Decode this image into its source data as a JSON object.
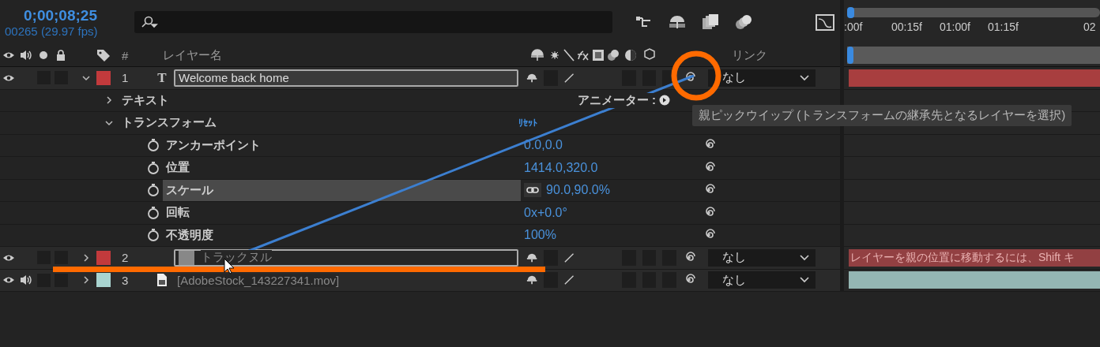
{
  "timecode": "0;00;08;25",
  "frame_info": "00265 (29.97 fps)",
  "ruler": {
    "ticks": [
      ":00f",
      "00:15f",
      "01:00f",
      "01:15f",
      "02"
    ],
    "level": 0
  },
  "headers": {
    "number": "#",
    "layer_name": "レイヤー名",
    "parent": "リンク"
  },
  "layers": [
    {
      "number": "1",
      "type_glyph": "T",
      "kind": "text",
      "name": "Welcome back home",
      "color": "#c23a3c",
      "visible": true,
      "audio": false,
      "expanded": true,
      "highlighted": true,
      "parent": "なし",
      "groups": [
        {
          "label": "テキスト",
          "expanded": false,
          "extra": "アニメーター :"
        },
        {
          "label": "トランスフォーム",
          "expanded": true,
          "extra": "ﾘｾｯﾄ",
          "properties": [
            {
              "name": "アンカーポイント",
              "value": "0.0,0.0",
              "selected": false,
              "linked": false
            },
            {
              "name": "位置",
              "value": "1414.0,320.0",
              "selected": false,
              "linked": false
            },
            {
              "name": "スケール",
              "value": "90.0,90.0%",
              "selected": true,
              "linked": true
            },
            {
              "name": "回転",
              "value": "0x+0.0°",
              "selected": false,
              "linked": false
            },
            {
              "name": "不透明度",
              "value": "100%",
              "selected": false,
              "linked": false
            }
          ]
        }
      ]
    },
    {
      "number": "2",
      "kind": "null",
      "name": "トラックヌル",
      "color": "#c23a3c",
      "visible": true,
      "audio": false,
      "expanded": false,
      "highlighted": true,
      "parent": "なし",
      "bar_text": "レイヤーを親の位置に移動するには、Shift キ"
    },
    {
      "number": "3",
      "kind": "footage",
      "name": "[AdobeStock_143227341.mov]",
      "color": "#a9d4d0",
      "visible": true,
      "audio": true,
      "expanded": false,
      "highlighted": false,
      "parent": "なし"
    }
  ],
  "tooltip": "親ピックウイップ (トランスフォームの継承先となるレイヤーを選択)"
}
